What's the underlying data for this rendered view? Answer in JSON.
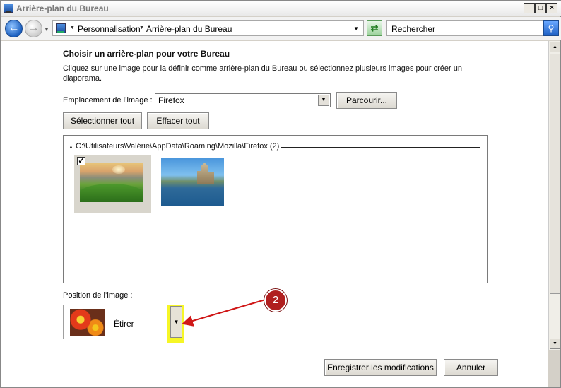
{
  "window": {
    "title": "Arrière-plan du Bureau",
    "min_glyph": "_",
    "max_glyph": "□",
    "close_glyph": "×"
  },
  "nav": {
    "back_icon": "back-arrow-icon",
    "forward_icon": "forward-arrow-icon",
    "breadcrumb": [
      "Personnalisation",
      "Arrière-plan du Bureau"
    ],
    "search_placeholder": "Rechercher"
  },
  "main": {
    "heading": "Choisir un arrière-plan pour votre Bureau",
    "description": "Cliquez sur une image pour la définir comme arrière-plan du Bureau ou sélectionnez plusieurs images pour créer un diaporama.",
    "location_label": "Emplacement de l’image :",
    "location_value": "Firefox",
    "browse_label": "Parcourir...",
    "select_all_label": "Sélectionner tout",
    "clear_all_label": "Effacer tout",
    "group_header": "C:\\Utilisateurs\\Valérie\\AppData\\Roaming\\Mozilla\\Firefox (2)",
    "images": [
      {
        "name": "landscape-hills",
        "selected": true
      },
      {
        "name": "castle-river",
        "selected": false
      }
    ],
    "position_label": "Position de l’image :",
    "position_value": "Étirer",
    "save_label": "Enregistrer les modifications",
    "cancel_label": "Annuler"
  },
  "annotation": {
    "badge_number": "2",
    "highlight_color": "#f5f500",
    "arrow_color": "#d01818"
  }
}
